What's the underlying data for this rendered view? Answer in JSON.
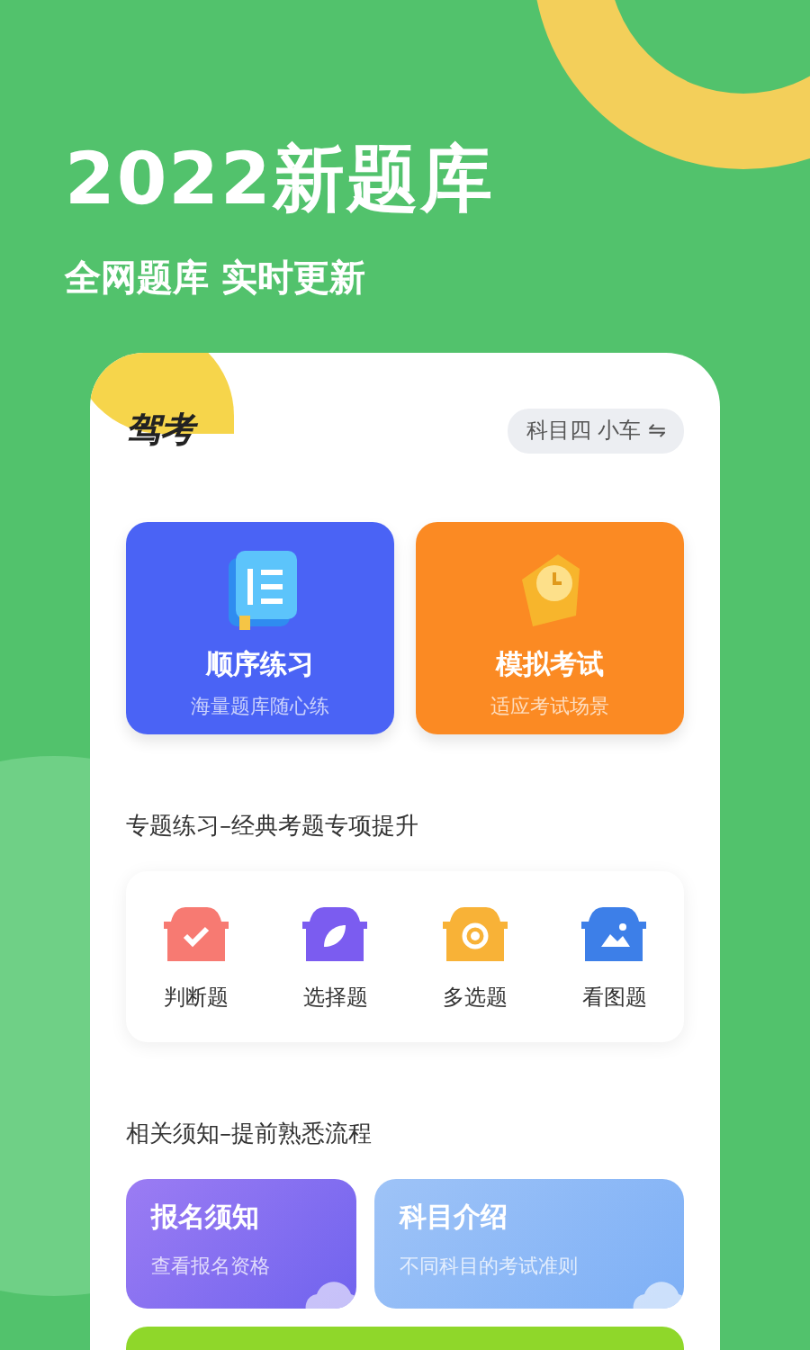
{
  "headline": "2022新题库",
  "subtitle": "全网题库 实时更新",
  "app": {
    "logo": "驾考",
    "subject_switch": "科目四 小车 ⇋",
    "main_cards": [
      {
        "kind": "book",
        "title": "顺序练习",
        "caption": "海量题库随心练"
      },
      {
        "kind": "clock",
        "title": "模拟考试",
        "caption": "适应考试场景"
      }
    ],
    "practice_section": {
      "title": "专题练习–经典考题专项提升",
      "items": [
        {
          "kind": "check",
          "label": "判断题",
          "color": "#f77a72"
        },
        {
          "kind": "leaf",
          "label": "选择题",
          "color": "#7b5cf0"
        },
        {
          "kind": "target",
          "label": "多选题",
          "color": "#f8b237"
        },
        {
          "kind": "picture",
          "label": "看图题",
          "color": "#3d7fe8"
        }
      ]
    },
    "notice_section": {
      "title": "相关须知–提前熟悉流程",
      "cards": [
        {
          "kind": "purple",
          "title": "报名须知",
          "caption": "查看报名资格"
        },
        {
          "kind": "blue",
          "title": "科目介绍",
          "caption": "不同科目的考试准则"
        }
      ]
    }
  }
}
